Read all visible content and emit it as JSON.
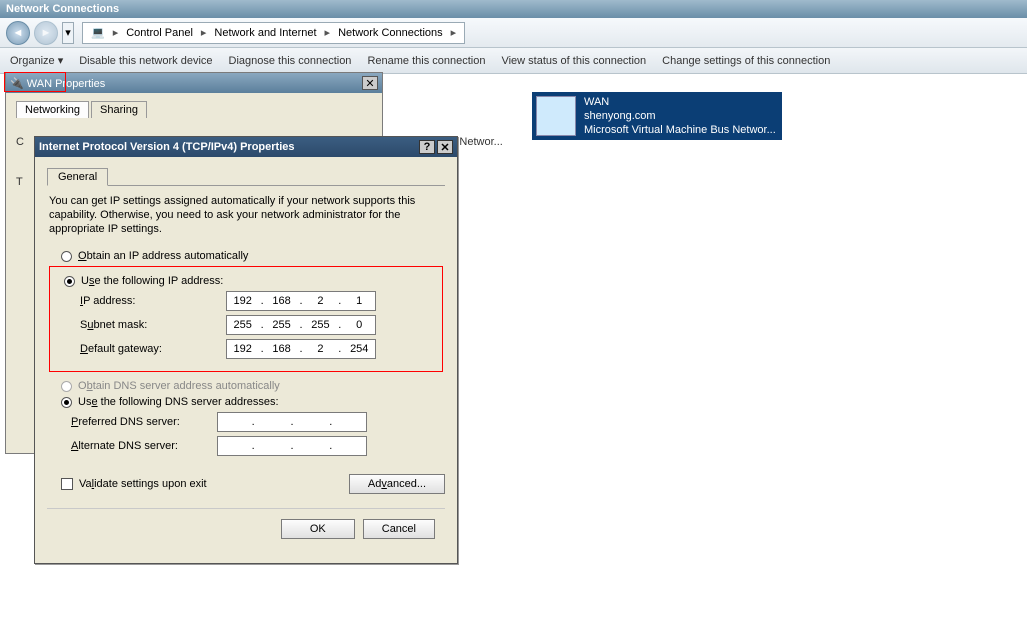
{
  "window": {
    "title": "Network Connections"
  },
  "breadcrumb": {
    "items": [
      "Control Panel",
      "Network and Internet",
      "Network Connections"
    ]
  },
  "commands": {
    "organize": "Organize",
    "disable": "Disable this network device",
    "diagnose": "Diagnose this connection",
    "rename": "Rename this connection",
    "view_status": "View status of this connection",
    "change_settings": "Change settings of this connection"
  },
  "connection": {
    "name": "WAN",
    "line2": "shenyong.com",
    "line3": "Microsoft Virtual Machine Bus Networ...",
    "partial_text": "tual Machine Bus Networ..."
  },
  "wan_props": {
    "title": "WAN Properties",
    "tabs": {
      "networking": "Networking",
      "sharing": "Sharing"
    }
  },
  "ipv4": {
    "title": "Internet Protocol Version 4 (TCP/IPv4) Properties",
    "tab_general": "General",
    "description": "You can get IP settings assigned automatically if your network supports this capability. Otherwise, you need to ask your network administrator for the appropriate IP settings.",
    "radio_auto_ip": "Obtain an IP address automatically",
    "radio_manual_ip": "Use the following IP address:",
    "ip_label": "IP address:",
    "subnet_label": "Subnet mask:",
    "gateway_label": "Default gateway:",
    "ip": {
      "a": "192",
      "b": "168",
      "c": "2",
      "d": "1"
    },
    "subnet": {
      "a": "255",
      "b": "255",
      "c": "255",
      "d": "0"
    },
    "gateway": {
      "a": "192",
      "b": "168",
      "c": "2",
      "d": "254"
    },
    "radio_auto_dns": "Obtain DNS server address automatically",
    "radio_manual_dns": "Use the following DNS server addresses:",
    "pref_dns_label": "Preferred DNS server:",
    "alt_dns_label": "Alternate DNS server:",
    "validate": "Validate settings upon exit",
    "advanced": "Advanced...",
    "ok": "OK",
    "cancel": "Cancel"
  }
}
